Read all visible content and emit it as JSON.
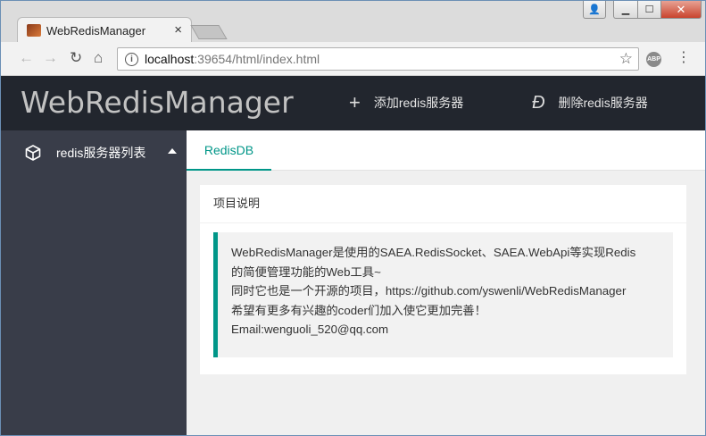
{
  "browser": {
    "tab_title": "WebRedisManager",
    "tab_close": "×",
    "url_host": "localhost",
    "url_rest": ":39654/html/index.html",
    "extension_badge": "ABP"
  },
  "window_controls": {
    "user": "👤",
    "minimize": "▁",
    "maximize": "☐",
    "close": "✕"
  },
  "app": {
    "logo": "WebRedisManager",
    "add_server_label": "添加redis服务器",
    "delete_server_label": "删除redis服务器",
    "add_icon": "+",
    "delete_icon": "Ð"
  },
  "sidebar": {
    "items": [
      {
        "label": "redis服务器列表",
        "icon": "cube-icon",
        "expanded": true
      }
    ]
  },
  "main": {
    "tabs": [
      {
        "label": "RedisDB",
        "active": true
      }
    ],
    "card": {
      "title": "项目说明",
      "lines": [
        "WebRedisManager是使用的SAEA.RedisSocket、SAEA.WebApi等实现Redis",
        "的简便管理功能的Web工具~",
        "同时它也是一个开源的项目，https://github.com/yswenli/WebRedisManager",
        "希望有更多有兴趣的coder们加入使它更加完善！",
        "Email:wenguoli_520@qq.com"
      ]
    }
  },
  "colors": {
    "header_bg": "#22262e",
    "sidebar_bg": "#393d49",
    "accent": "#009688"
  }
}
